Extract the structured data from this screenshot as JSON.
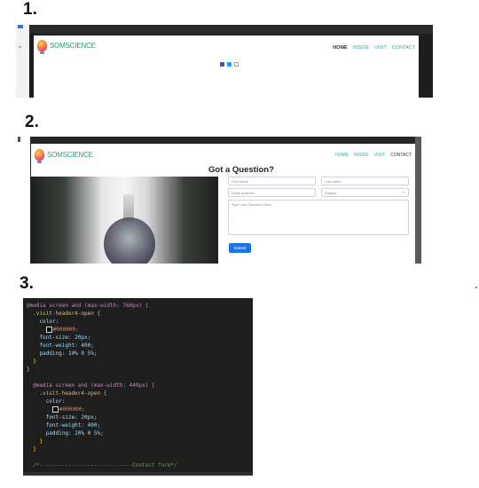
{
  "labels": {
    "one": "1.",
    "two": "2.",
    "three": "3."
  },
  "brand": "SOMSCIENCE",
  "shot1": {
    "nav": [
      "HOME",
      "INSIDE",
      "VISIT",
      "CONTACT"
    ],
    "active": "HOME",
    "social_icons": [
      "facebook-icon",
      "twitter-icon",
      "instagram-icon"
    ]
  },
  "shot2": {
    "nav": [
      "HOME",
      "INSIDE",
      "VISIT",
      "CONTACT"
    ],
    "active": "CONTACT",
    "heading": "Got a Question?",
    "first_name_placeholder": "First name",
    "last_name_placeholder": "Last name",
    "email_placeholder": "Email Address",
    "subject_placeholder": "Subject",
    "question_placeholder": "Type Your Question Here",
    "submit_label": "Submit"
  },
  "code": {
    "l1": "@media screen and (max-width: 760px) {",
    "l2": "  .visit-header4-open {",
    "l3": "    color:",
    "l3v": "#000000;",
    "l4": "    font-size: 20px;",
    "l5": "    font-weight: 400;",
    "l6": "    padding: 10% 0 5%;",
    "l7": "  }",
    "l8": "}",
    "l9": "  @media screen and (max-width: 440px) {",
    "l10": "    .visit-header4-open {",
    "l11": "      color:",
    "l11v": "#000000;",
    "l12": "      font-size: 20px;",
    "l13": "      font-weight: 400;",
    "l14": "      padding: 20% 0 5%;",
    "l15": "    }",
    "l16": "  }",
    "l17": "  /*-----------------------------Contact form*/"
  },
  "colors": {
    "brand": "#2f9e6e",
    "nav": "#39a7a0",
    "submit": "#1a73e8",
    "editor_bg": "#1e1e1e"
  }
}
